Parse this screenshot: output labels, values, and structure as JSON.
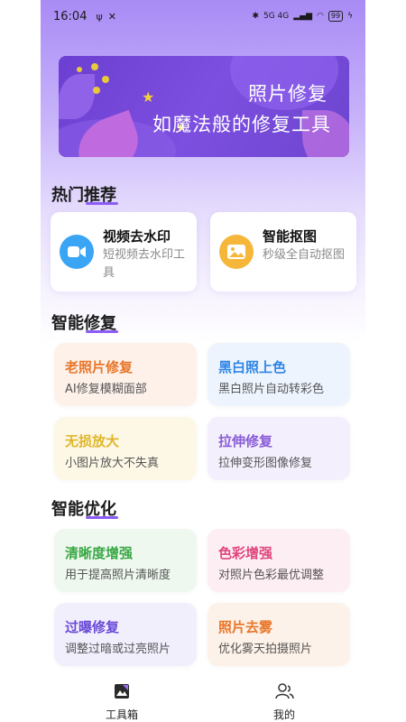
{
  "status_bar": {
    "time": "16:04",
    "left_icons": [
      "usb-icon",
      "tools-icon"
    ],
    "right_text": "5G 4G",
    "battery": "99"
  },
  "banner": {
    "line1": "照片修复",
    "line2": "如魔法般的修复工具"
  },
  "sections": {
    "hot": "热门推荐",
    "repair": "智能修复",
    "optimize": "智能优化"
  },
  "hot_cards": [
    {
      "title": "视频去水印",
      "desc": "短视频去水印工具",
      "icon": "video-camera-icon",
      "color": "#3aa4f5"
    },
    {
      "title": "智能抠图",
      "desc": "秒级全自动抠图",
      "icon": "image-icon",
      "color": "#f6b63a"
    }
  ],
  "repair_cards": [
    {
      "title": "老照片修复",
      "desc": "AI修复模糊面部",
      "title_color": "#e8762a",
      "bg": "#fdf1ea"
    },
    {
      "title": "黑白照上色",
      "desc": "黑白照片自动转彩色",
      "title_color": "#2f86e6",
      "bg": "#eef4fe"
    },
    {
      "title": "无损放大",
      "desc": "小图片放大不失真",
      "title_color": "#e0b62a",
      "bg": "#fdf8e6"
    },
    {
      "title": "拉伸修复",
      "desc": "拉伸变形图像修复",
      "title_color": "#8a5cd6",
      "bg": "#f3effd"
    }
  ],
  "optimize_cards": [
    {
      "title": "清晰度增强",
      "desc": "用于提高照片清晰度",
      "title_color": "#3aa845",
      "bg": "#eef8ef"
    },
    {
      "title": "色彩增强",
      "desc": "对照片色彩最优调整",
      "title_color": "#e0457e",
      "bg": "#fdeef3"
    },
    {
      "title": "过曝修复",
      "desc": "调整过暗或过亮照片",
      "title_color": "#6a4ad6",
      "bg": "#f2effd"
    },
    {
      "title": "照片去雾",
      "desc": "优化雾天拍摄照片",
      "title_color": "#e8762a",
      "bg": "#fdf2e9"
    }
  ],
  "bottom_nav": {
    "toolbox": "工具箱",
    "mine": "我的"
  }
}
